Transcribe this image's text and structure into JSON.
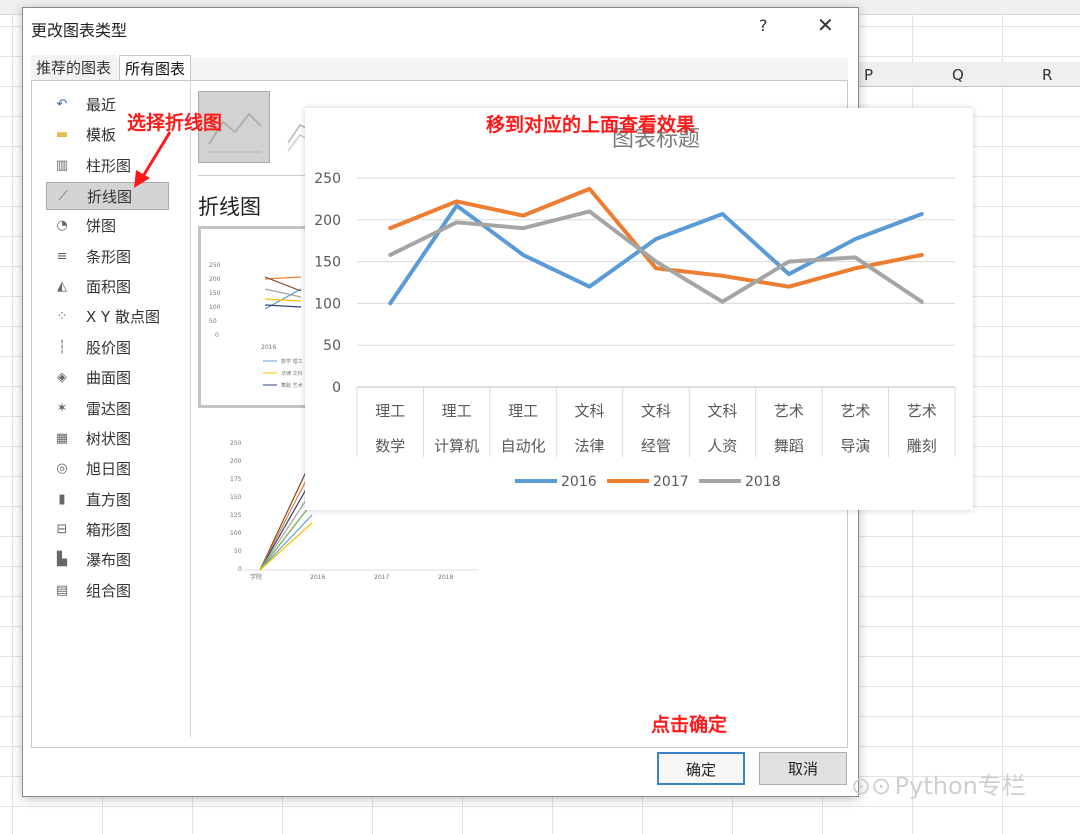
{
  "sheet": {
    "columns": [
      "P",
      "Q",
      "R"
    ]
  },
  "dialog": {
    "title": "更改图表类型",
    "help": "?",
    "close": "✕",
    "tabs": [
      {
        "label": "推荐的图表"
      },
      {
        "label": "所有图表"
      }
    ],
    "chart_types": [
      {
        "label": "最近",
        "icon": "recent-icon"
      },
      {
        "label": "模板",
        "icon": "folder-icon"
      },
      {
        "label": "柱形图",
        "icon": "column-chart-icon"
      },
      {
        "label": "折线图",
        "icon": "line-chart-icon",
        "selected": true
      },
      {
        "label": "饼图",
        "icon": "pie-chart-icon"
      },
      {
        "label": "条形图",
        "icon": "bar-chart-icon"
      },
      {
        "label": "面积图",
        "icon": "area-chart-icon"
      },
      {
        "label": "X Y 散点图",
        "icon": "scatter-chart-icon"
      },
      {
        "label": "股价图",
        "icon": "stock-chart-icon"
      },
      {
        "label": "曲面图",
        "icon": "surface-chart-icon"
      },
      {
        "label": "雷达图",
        "icon": "radar-chart-icon"
      },
      {
        "label": "树状图",
        "icon": "treemap-chart-icon"
      },
      {
        "label": "旭日图",
        "icon": "sunburst-chart-icon"
      },
      {
        "label": "直方图",
        "icon": "histogram-chart-icon"
      },
      {
        "label": "箱形图",
        "icon": "boxplot-chart-icon"
      },
      {
        "label": "瀑布图",
        "icon": "waterfall-chart-icon"
      },
      {
        "label": "组合图",
        "icon": "combo-chart-icon"
      }
    ],
    "section_title": "折线图",
    "ok_label": "确定",
    "cancel_label": "取消"
  },
  "annotations": {
    "select_line": "选择折线图",
    "hover_preview": "移到对应的上面查看效果",
    "click_ok": "点击确定"
  },
  "watermark": "Python专栏",
  "colors": {
    "s2016": "#5b9bd5",
    "s2017": "#ed7d31",
    "s2018": "#a5a5a5",
    "annotation": "#ff1a1a",
    "ok_border": "#3c82c8"
  },
  "chart_data": {
    "type": "line",
    "title": "图表标题",
    "categories": [
      [
        "理工",
        "数学"
      ],
      [
        "理工",
        "计算机"
      ],
      [
        "理工",
        "自动化"
      ],
      [
        "文科",
        "法律"
      ],
      [
        "文科",
        "经管"
      ],
      [
        "文科",
        "人资"
      ],
      [
        "艺术",
        "舞蹈"
      ],
      [
        "艺术",
        "导演"
      ],
      [
        "艺术",
        "雕刻"
      ]
    ],
    "series": [
      {
        "name": "2016",
        "color": "#5b9bd5",
        "values": [
          100,
          217,
          158,
          120,
          177,
          207,
          135,
          177,
          207
        ]
      },
      {
        "name": "2017",
        "color": "#ed7d31",
        "values": [
          190,
          222,
          205,
          237,
          142,
          133,
          120,
          142,
          158
        ]
      },
      {
        "name": "2018",
        "color": "#a5a5a5",
        "values": [
          158,
          197,
          190,
          210,
          150,
          102,
          150,
          155,
          102
        ]
      }
    ],
    "ylim": [
      0,
      250
    ],
    "yticks": [
      0,
      50,
      100,
      150,
      200,
      250
    ],
    "grid": true,
    "legend": "bottom"
  }
}
